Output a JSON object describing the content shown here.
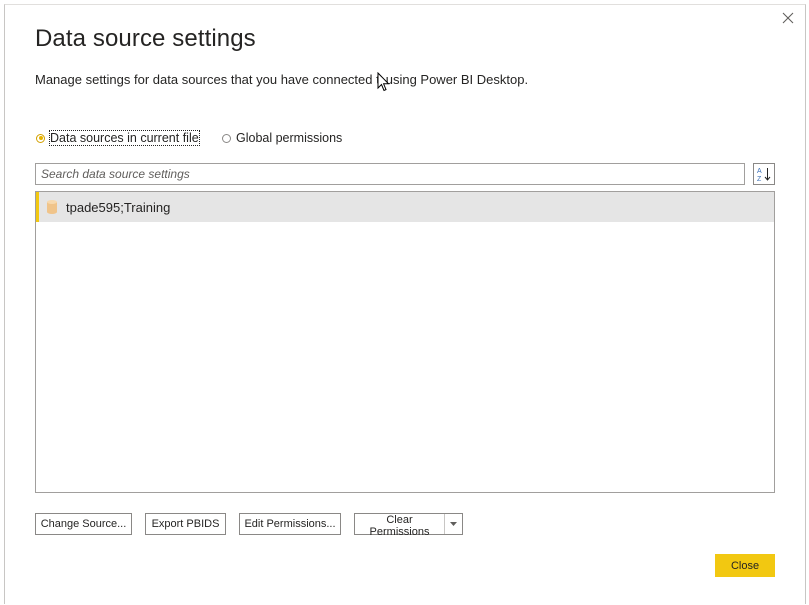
{
  "dialog": {
    "title": "Data source settings",
    "subtitle_before": "Manage settings for data sources that you have connected t",
    "subtitle_after": "using Power BI Desktop."
  },
  "scope": {
    "options": [
      {
        "label": "Data sources in current file",
        "selected": true
      },
      {
        "label": "Global permissions",
        "selected": false
      }
    ]
  },
  "search": {
    "placeholder": "Search data source settings",
    "value": ""
  },
  "sort": {
    "icon": "sort-az-icon"
  },
  "sources": [
    {
      "label": "tpade595;Training",
      "icon": "database-icon",
      "selected": true
    }
  ],
  "actions": {
    "change_source": "Change Source...",
    "export_pbids": "Export PBIDS",
    "edit_permissions": "Edit Permissions...",
    "clear_permissions": "Clear Permissions",
    "close": "Close"
  },
  "colors": {
    "accent": "#f2c811",
    "selected_row": "#e5e5e5"
  }
}
